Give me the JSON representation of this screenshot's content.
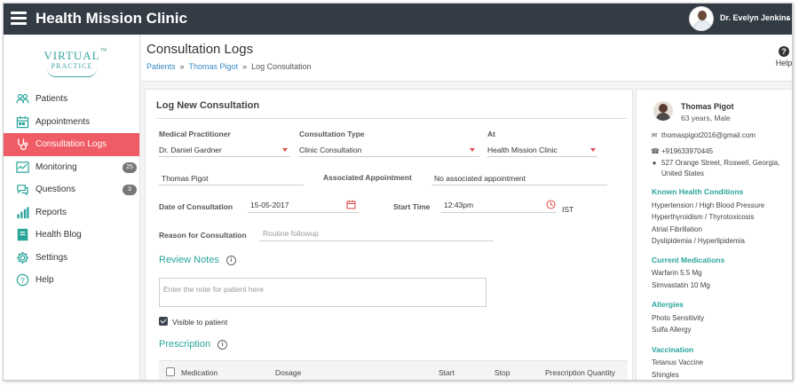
{
  "header": {
    "app_title": "Health Mission Clinic",
    "user_name": "Dr. Evelyn Jenkins"
  },
  "logo": {
    "line1": "VIRTUAL",
    "line2": "PRACTICE",
    "tm": "TM"
  },
  "sidebar": {
    "items": [
      {
        "label": "Patients",
        "icon": "patients-icon"
      },
      {
        "label": "Appointments",
        "icon": "calendar-icon"
      },
      {
        "label": "Consultation Logs",
        "icon": "stethoscope-icon",
        "active": true
      },
      {
        "label": "Monitoring",
        "icon": "monitoring-icon",
        "badge": "25"
      },
      {
        "label": "Questions",
        "icon": "chat-icon",
        "badge": "3"
      },
      {
        "label": "Reports",
        "icon": "bar-chart-icon"
      },
      {
        "label": "Health Blog",
        "icon": "book-icon"
      },
      {
        "label": "Settings",
        "icon": "gear-icon"
      },
      {
        "label": "Help",
        "icon": "question-icon"
      }
    ]
  },
  "page": {
    "title": "Consultation Logs",
    "breadcrumb": [
      "Patients",
      "Thomas Pigot",
      "Log Consultation"
    ],
    "breadcrumb_sep": "»",
    "help_label": "Help"
  },
  "form": {
    "title": "Log New Consultation",
    "practitioner_label": "Medical Practitioner",
    "practitioner_value": "Dr. Daniel Gardner",
    "type_label": "Consultation Type",
    "type_value": "Clinic Consultation",
    "at_label": "At",
    "at_value": "Health Mission Clinic",
    "patient_value": "Thomas Pigot",
    "appointment_label": "Associated Appointment",
    "appointment_value": "No associated appointment",
    "date_label": "Date of Consultation",
    "date_value": "15-05-2017",
    "time_label": "Start Time",
    "time_value": "12:43pm",
    "timezone": "IST",
    "reason_label": "Reason for Consultation",
    "reason_placeholder": "Routine followup",
    "review_notes_title": "Review Notes",
    "notes_placeholder": "Enter the note for patient here",
    "visible_label": "Visible to patient",
    "visible_checked": true,
    "prescription_title": "Prescription",
    "table_headers": [
      "Medication",
      "Dosage",
      "Start",
      "Stop",
      "Prescription Quantity"
    ]
  },
  "patient": {
    "name": "Thomas Pigot",
    "age_sex": "63 years, Male",
    "email": "thomaspigot2016@gmail.com",
    "phone": "+919633970445",
    "address_line1": "527 Orange Street, Roswell, Georgia,",
    "address_line2": "United States",
    "conditions_title": "Known Health Conditions",
    "conditions": [
      "Hypertension / High Blood Pressure",
      "Hyperthyroidism / Thyrotoxicosis",
      "Atrial Fibrillation",
      "Dyslipidemia / Hyperlipidemia"
    ],
    "medications_title": "Current Medications",
    "medications": [
      "Warfarin 5.5 Mg",
      "Simvastatin 10 Mg"
    ],
    "allergies_title": "Allergies",
    "allergies": [
      "Photo Sensitivity",
      "Sulfa Allergy"
    ],
    "vaccination_title": "Vaccination",
    "vaccinations": [
      "Tetanus Vaccine",
      "Shingles"
    ]
  },
  "colors": {
    "topbar": "#333b45",
    "active_nav": "#f05c65",
    "accent_teal": "#2aa59b",
    "link_blue": "#3a8bc4",
    "caret_red": "#e04a4a"
  }
}
